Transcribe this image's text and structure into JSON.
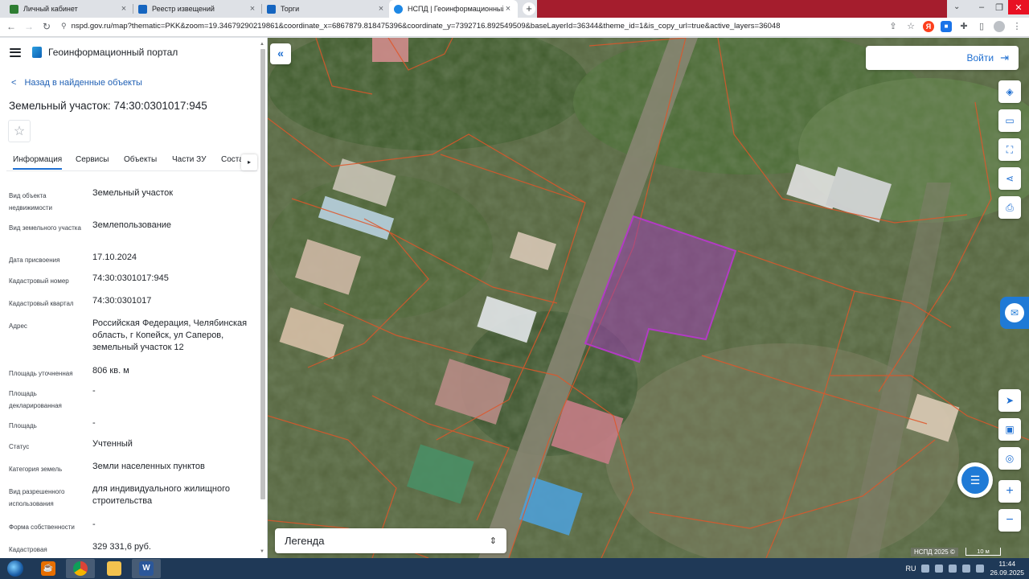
{
  "browser": {
    "tabs": [
      {
        "title": "Личный кабинет",
        "color": "#2e7d32",
        "active": false
      },
      {
        "title": "Реестр извещений",
        "color": "#1565c0",
        "active": false
      },
      {
        "title": "Торги",
        "color": "#1565c0",
        "active": false
      },
      {
        "title": "НСПД | Геоинформационный п",
        "color": "#1e88e5",
        "active": true
      }
    ],
    "newtab_label": "+",
    "close_label": "×",
    "url": "nspd.gov.ru/map?thematic=PKK&zoom=19.34679290219861&coordinate_x=6867879.818475396&coordinate_y=7392716.892549509&baseLayerId=36344&theme_id=1&is_copy_url=true&active_layers=36048",
    "nav": {
      "back": "←",
      "forward": "→",
      "reload": "↻"
    }
  },
  "portal": {
    "title": "Геоинформационный портал",
    "back_link": "Назад в найденные объекты",
    "object_title": "Земельный участок: 74:30:0301017:945",
    "favorite_icon": "☆",
    "tabs": [
      "Информация",
      "Сервисы",
      "Объекты",
      "Части ЗУ",
      "Соста"
    ],
    "tabs_more": "▸",
    "fields": [
      {
        "label": "Вид объекта недвижимости",
        "value": "Земельный участок"
      },
      {
        "label": "Вид земельного участка",
        "value": "Землепользование"
      },
      {
        "label": "Дата присвоения",
        "value": "17.10.2024"
      },
      {
        "label": "Кадастровый номер",
        "value": "74:30:0301017:945"
      },
      {
        "label": "Кадастровый квартал",
        "value": "74:30:0301017"
      },
      {
        "label": "Адрес",
        "value": "Российская Федерация, Челябинская область, г Копейск, ул Саперов, земельный участок 12"
      },
      {
        "label": "Площадь уточненная",
        "value": "806 кв. м"
      },
      {
        "label": "Площадь декларированная",
        "value": "-"
      },
      {
        "label": "Площадь",
        "value": "-"
      },
      {
        "label": "Статус",
        "value": "Учтенный"
      },
      {
        "label": "Категория земель",
        "value": "Земли населенных пунктов"
      },
      {
        "label": "Вид разрешенного использования",
        "value": "для индивидуального жилищного строительства"
      },
      {
        "label": "Форма собственности",
        "value": "-"
      },
      {
        "label": "Кадастровая",
        "value": "329 331,6 руб."
      }
    ]
  },
  "map": {
    "login_label": "Войти",
    "legend_label": "Легенда",
    "attribution": "НСПД 2025 ©",
    "scale": "10 м",
    "colors": {
      "parcel_border": "#e0562a",
      "selected_fill": "#9b3fae",
      "selected_border": "#b23bc4"
    }
  },
  "taskbar": {
    "lang": "RU",
    "time": "11:44",
    "date": "26.09.2025"
  }
}
